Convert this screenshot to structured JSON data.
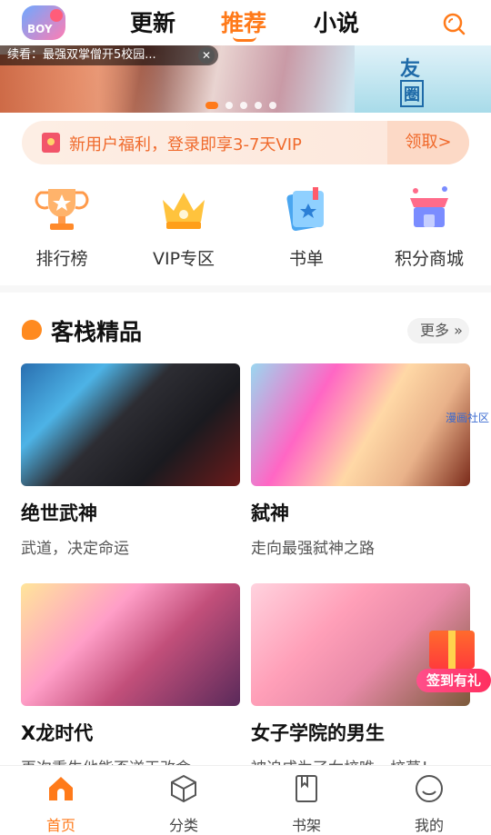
{
  "header": {
    "logo_text": "BOY",
    "tabs": [
      {
        "label": "更新",
        "active": false
      },
      {
        "label": "推荐",
        "active": true
      },
      {
        "label": "小说",
        "active": false
      }
    ]
  },
  "banner": {
    "ticker_text": "续看：最强双掌僧开5校园...",
    "side_text_1": "友",
    "side_text_2": "圈",
    "dots_count": 5,
    "active_dot": 0
  },
  "promo": {
    "text": "新用户福利，登录即享3-7天VIP",
    "button_label": "领取>"
  },
  "quick_links": [
    {
      "label": "排行榜",
      "icon": "trophy-icon"
    },
    {
      "label": "VIP专区",
      "icon": "crown-icon"
    },
    {
      "label": "书单",
      "icon": "book-list-icon"
    },
    {
      "label": "积分商城",
      "icon": "store-icon"
    }
  ],
  "section": {
    "title": "客栈精品",
    "more_label": "更多"
  },
  "cards": [
    {
      "title": "绝世武神",
      "desc": "武道，决定命运"
    },
    {
      "title": "弑神",
      "desc": "走向最强弑神之路"
    },
    {
      "title": "X龙时代",
      "desc": "再次重生他能否逆天改命"
    },
    {
      "title": "女子学院的男生",
      "desc": "被迫成为了女校唯一校草！"
    }
  ],
  "watermark": "漫画社区",
  "gift_label": "签到有礼",
  "bottom_nav": [
    {
      "label": "首页",
      "icon": "home-icon",
      "active": true
    },
    {
      "label": "分类",
      "icon": "category-icon",
      "active": false
    },
    {
      "label": "书架",
      "icon": "bookshelf-icon",
      "active": false
    },
    {
      "label": "我的",
      "icon": "profile-icon",
      "active": false
    }
  ],
  "colors": {
    "accent": "#ff7a1a",
    "promo_text": "#f06a2c"
  }
}
